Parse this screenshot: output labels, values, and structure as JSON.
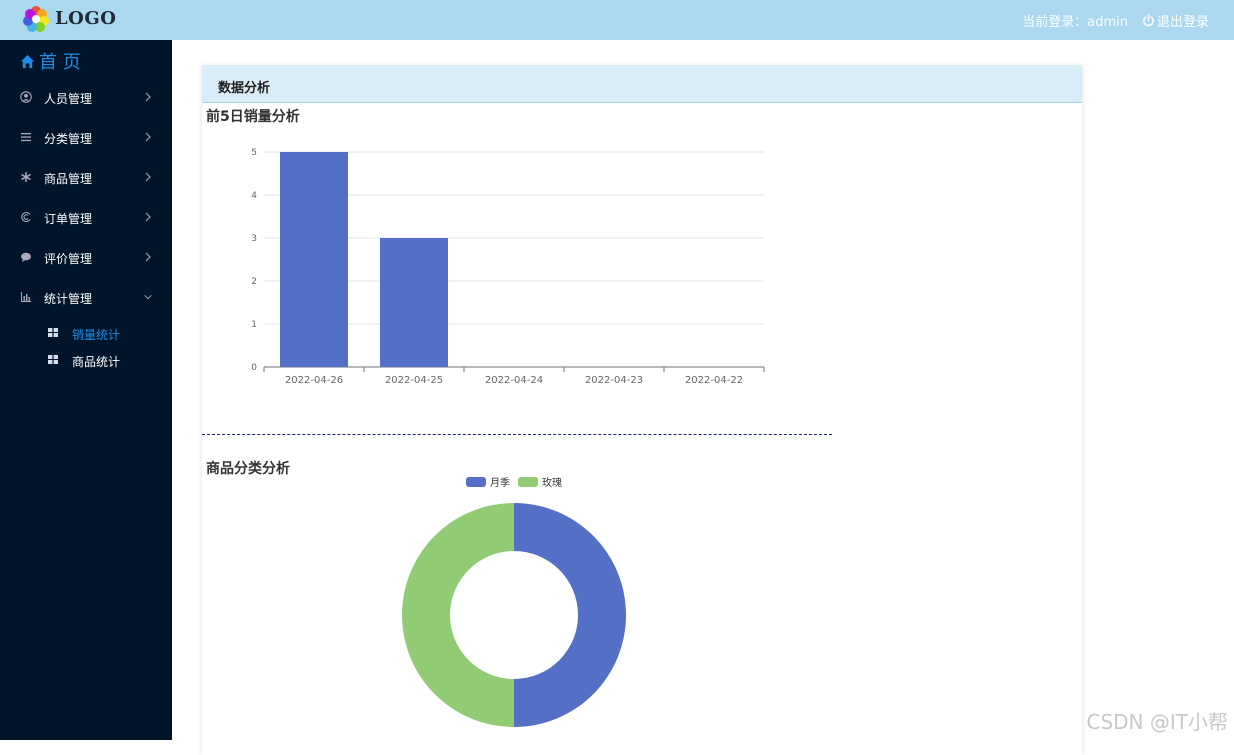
{
  "header": {
    "logo_text": "LOGO",
    "login_status": "当前登录：admin",
    "logout_label": "退出登录"
  },
  "sidebar": {
    "home_label": "首 页",
    "menu": [
      {
        "label": "人员管理",
        "icon": "user-circle-icon"
      },
      {
        "label": "分类管理",
        "icon": "list-icon"
      },
      {
        "label": "商品管理",
        "icon": "asterisk-icon"
      },
      {
        "label": "订单管理",
        "icon": "order-icon"
      },
      {
        "label": "评价管理",
        "icon": "comment-icon"
      },
      {
        "label": "统计管理",
        "icon": "bar-chart-icon",
        "expanded": true
      }
    ],
    "submenu": [
      {
        "label": "销量统计",
        "active": true
      },
      {
        "label": "商品统计",
        "active": false
      }
    ]
  },
  "main": {
    "card_title": "数据分析",
    "sales_title": "前5日销量分析",
    "category_title": "商品分类分析"
  },
  "chart_data": [
    {
      "type": "bar",
      "categories": [
        "2022-04-26",
        "2022-04-25",
        "2022-04-24",
        "2022-04-23",
        "2022-04-22"
      ],
      "values": [
        5,
        3,
        0,
        0,
        0
      ],
      "ylim": [
        0,
        5
      ],
      "yticks": [
        "0",
        "1",
        "2",
        "3",
        "4",
        "5"
      ],
      "color": "#5470c6"
    },
    {
      "type": "pie",
      "labels": [
        "月季",
        "玫瑰"
      ],
      "values": [
        1,
        1
      ],
      "colors": [
        "#5470c6",
        "#91cc75"
      ],
      "legend_position": "top"
    }
  ],
  "colors": {
    "topbar": "#a9d8ef",
    "sidebar": "#001529",
    "accent": "#1e8ee8"
  },
  "watermark": "CSDN @IT小帮"
}
